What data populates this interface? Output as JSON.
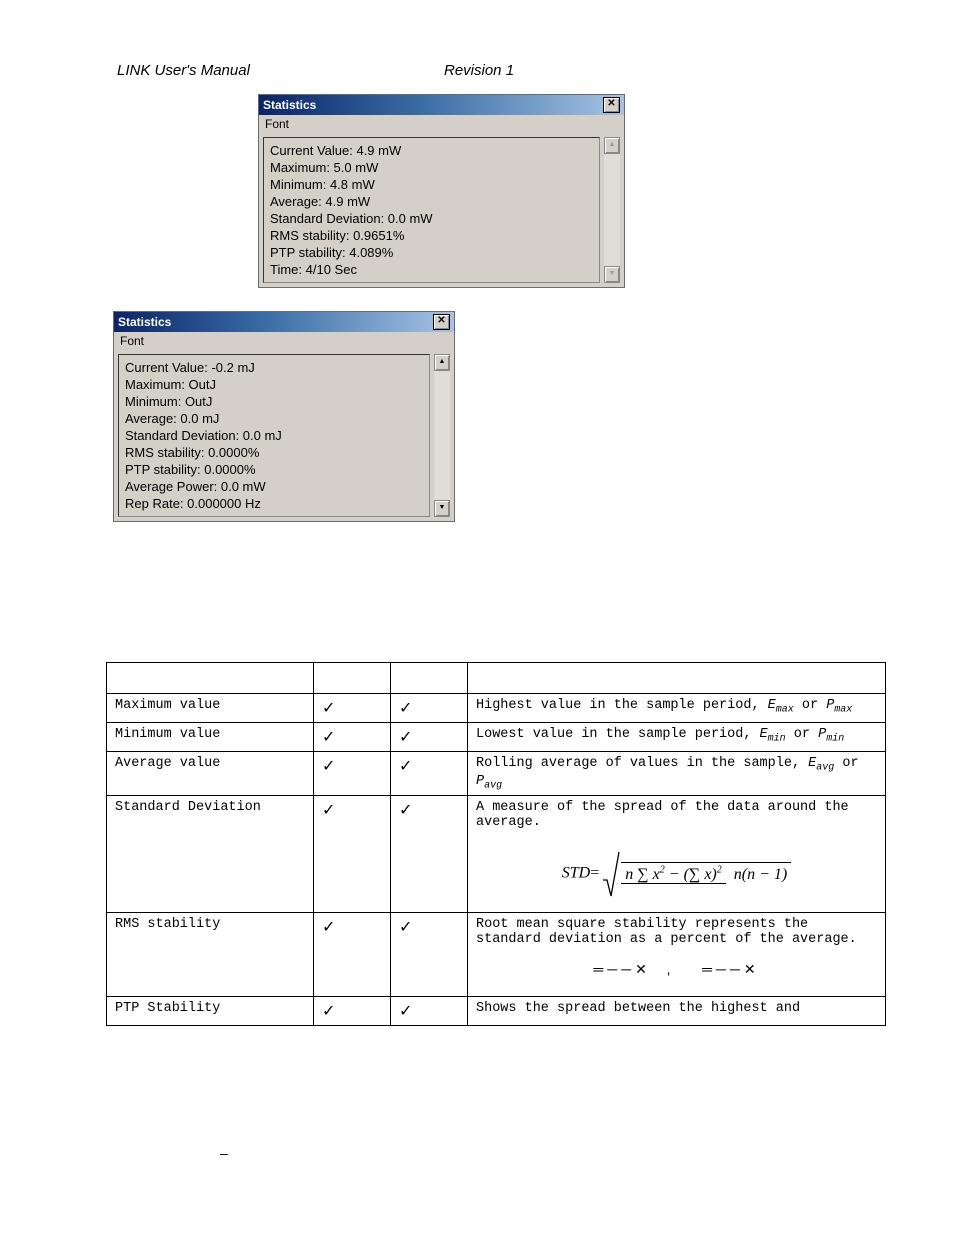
{
  "header": {
    "left": "LINK  User's Manual",
    "center": "Revision  1"
  },
  "panel1": {
    "title": "Statistics",
    "menu": "Font",
    "lines": [
      "Current Value: 4.9 mW",
      "Maximum: 5.0 mW",
      "Minimum: 4.8 mW",
      "Average: 4.9 mW",
      "Standard Deviation: 0.0 mW",
      "RMS stability: 0.9651%",
      "PTP stability: 4.089%",
      "Time: 4/10  Sec"
    ]
  },
  "panel2": {
    "title": "Statistics",
    "menu": "Font",
    "lines": [
      "Current Value: -0.2 mJ",
      "Maximum: OutJ",
      "Minimum: OutJ",
      "Average: 0.0 mJ",
      "Standard Deviation: 0.0 mJ",
      "RMS stability: 0.0000%",
      "PTP stability: 0.0000%",
      "Average Power: 0.0 mW",
      "Rep Rate: 0.000000 Hz"
    ]
  },
  "check": "✓",
  "table": {
    "rows": [
      {
        "name": "Maximum value",
        "c1": true,
        "c2": true,
        "desc_html": "Highest value in the sample period, <span class='ital'>E<span class='sub'>max</span></span> or <span class='ital'>P<span class='sub'>max</span></span>"
      },
      {
        "name": "Minimum value",
        "c1": true,
        "c2": true,
        "desc_html": "Lowest value in the sample period, <span class='ital'>E<span class='sub'>min</span></span> or <span class='ital'>P<span class='sub'>min</span></span>"
      },
      {
        "name": "Average value",
        "c1": true,
        "c2": true,
        "desc_html": "Rolling average of values in the sample, <span class='ital'>E<span class='sub'>avg</span></span> or <span class='ital'>P<span class='sub'>avg</span></span>"
      },
      {
        "name": "Standard Deviation",
        "c1": true,
        "c2": true,
        "desc_html": "A measure of the spread of the data around the average.",
        "formula": true
      },
      {
        "name": "RMS stability",
        "c1": true,
        "c2": true,
        "desc_html": "Root mean square stability represents the standard deviation as a percent of the average.",
        "xrow": true
      },
      {
        "name": "PTP Stability",
        "c1": true,
        "c2": true,
        "desc_html": "Shows the spread between the highest and"
      }
    ]
  },
  "footer": {
    "dash": "–"
  }
}
